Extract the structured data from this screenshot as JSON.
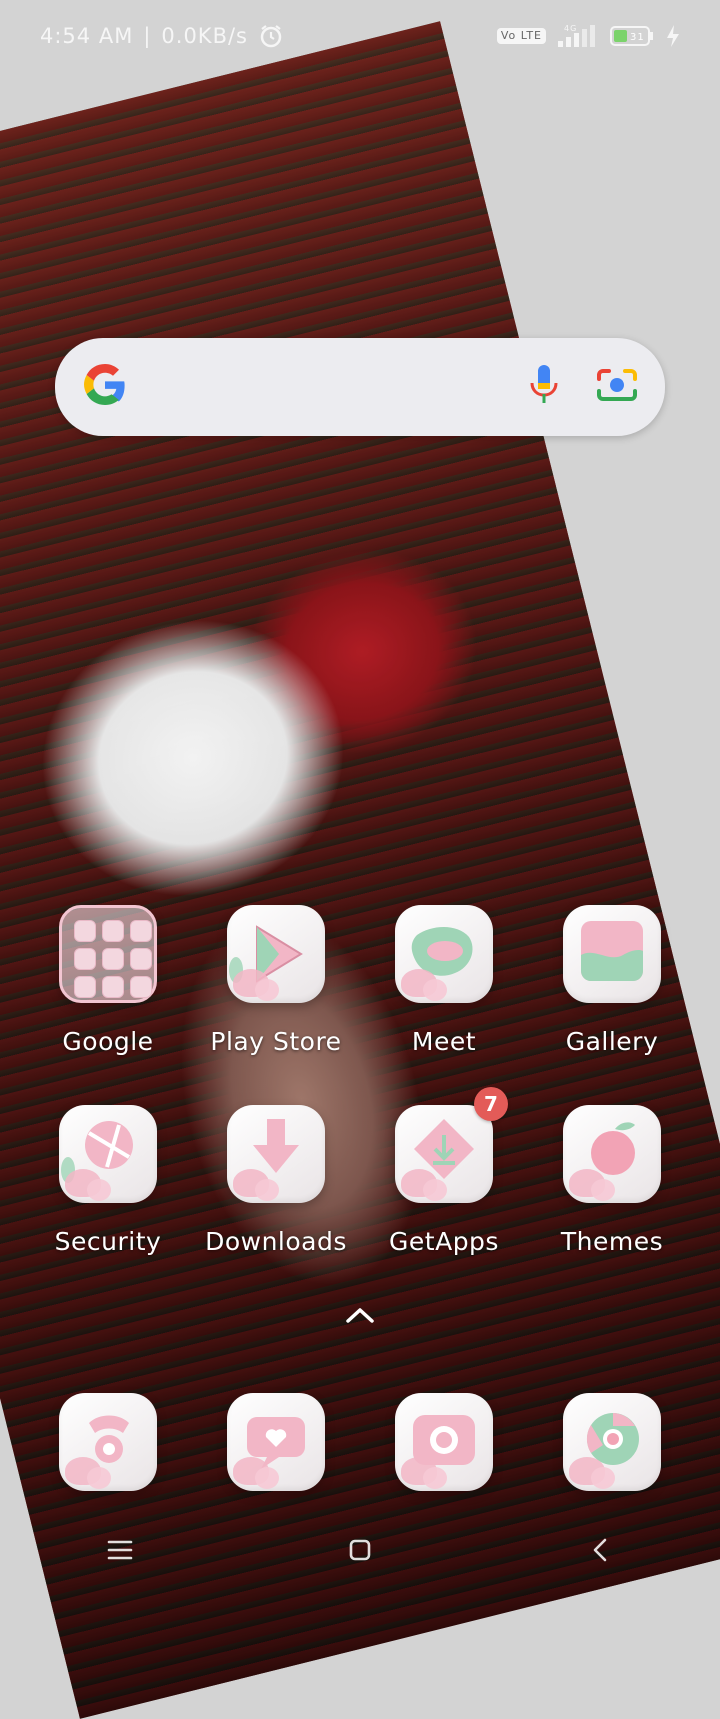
{
  "status_bar": {
    "time": "4:54 AM",
    "separator": "|",
    "speed": "0.0KB/s",
    "volte": "Vo LTE",
    "network": "4G",
    "battery": "31"
  },
  "search": {
    "google_logo": "google-g-icon",
    "mic_icon": "mic-icon",
    "lens_icon": "lens-camera-icon"
  },
  "apps": [
    {
      "label": "Google",
      "icon": "google-folder"
    },
    {
      "label": "Play Store",
      "icon": "play-store-icon"
    },
    {
      "label": "Meet",
      "icon": "meet-icon"
    },
    {
      "label": "Gallery",
      "icon": "gallery-icon"
    },
    {
      "label": "Security",
      "icon": "security-icon"
    },
    {
      "label": "Downloads",
      "icon": "downloads-icon"
    },
    {
      "label": "GetApps",
      "icon": "getapps-icon",
      "badge": "7"
    },
    {
      "label": "Themes",
      "icon": "themes-icon"
    }
  ],
  "dock": [
    {
      "icon": "phone-icon"
    },
    {
      "icon": "messages-icon"
    },
    {
      "icon": "camera-icon"
    },
    {
      "icon": "chrome-icon"
    }
  ],
  "navigation": {
    "menu": "menu-icon",
    "home": "home-icon",
    "back": "back-icon"
  },
  "colors": {
    "accent_pink": "#f2b6c6",
    "accent_green": "#9fd4b6",
    "badge_red": "#e35b58"
  }
}
